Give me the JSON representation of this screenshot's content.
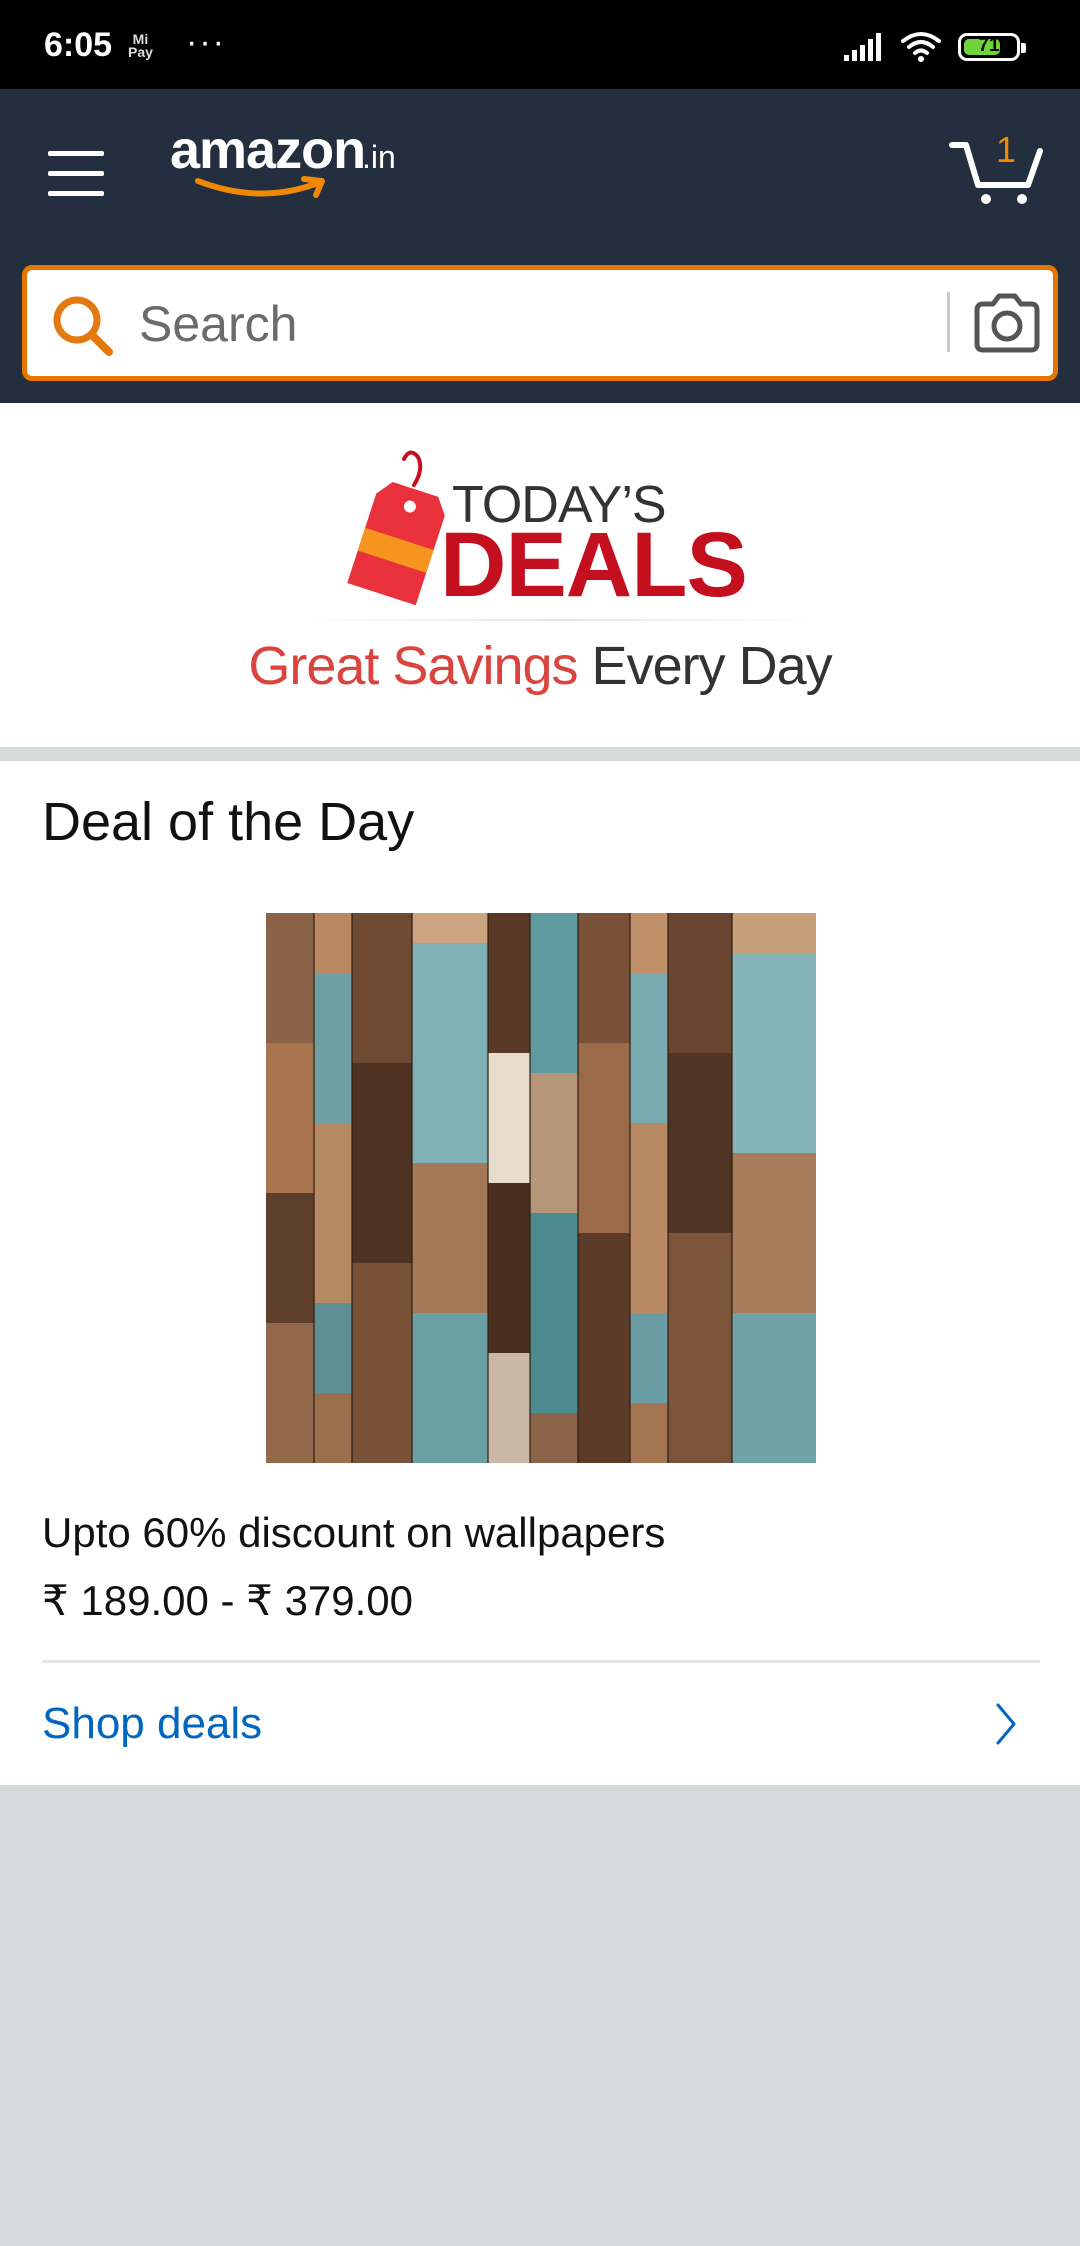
{
  "status_bar": {
    "time": "6:05",
    "mipay_line1": "Mi",
    "mipay_line2": "Pay",
    "more": "···",
    "battery": "71",
    "battery_level": 0.71
  },
  "header": {
    "logo_word": "amazon",
    "logo_tld": ".in",
    "cart_count": "1",
    "search_placeholder": "Search"
  },
  "deals_banner": {
    "todays": "TODAY’S",
    "deals": "DEALS",
    "tagline_red": "Great Savings",
    "tagline_dark": "Every Day"
  },
  "deal_card": {
    "title": "Deal of the Day",
    "description": "Upto 60% discount on wallpapers",
    "price": "₹ 189.00 - ₹ 379.00",
    "link_label": "Shop deals"
  },
  "colors": {
    "header": "#232f3e",
    "accent_orange": "#e77600",
    "deals_red": "#c40f1f",
    "link_blue": "#0066c0",
    "page_bg": "#d5dbdb"
  },
  "icons": [
    "menu-icon",
    "cart-icon",
    "search-icon",
    "camera-icon",
    "price-tag-icon",
    "chevron-right-icon",
    "signal-icon",
    "wifi-icon",
    "battery-icon"
  ]
}
